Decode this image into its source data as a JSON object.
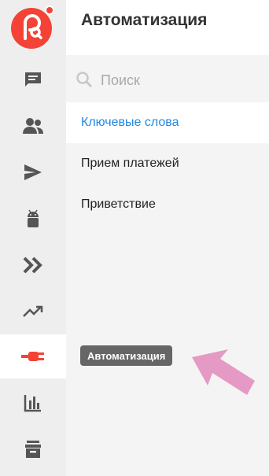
{
  "app": {
    "title": "Автоматизация",
    "accent_color": "#f44336",
    "link_color": "#1e88e5"
  },
  "sidebar": {
    "items": [
      {
        "name": "chat",
        "icon": "chat-icon",
        "active": false
      },
      {
        "name": "contacts",
        "icon": "people-icon",
        "active": false
      },
      {
        "name": "broadcast",
        "icon": "send-icon",
        "active": false
      },
      {
        "name": "bots",
        "icon": "android-icon",
        "active": false
      },
      {
        "name": "flows",
        "icon": "double-chevron-icon",
        "active": false
      },
      {
        "name": "growth",
        "icon": "trending-up-icon",
        "active": false
      },
      {
        "name": "automation",
        "icon": "plug-icon",
        "active": true
      },
      {
        "name": "analytics",
        "icon": "bar-chart-icon",
        "active": false
      },
      {
        "name": "archive",
        "icon": "archive-icon",
        "active": false
      }
    ]
  },
  "search": {
    "placeholder": "Поиск"
  },
  "list": {
    "items": [
      {
        "label": "Ключевые слова",
        "selected": true
      },
      {
        "label": "Прием платежей",
        "selected": false
      },
      {
        "label": "Приветствие",
        "selected": false
      }
    ]
  },
  "tooltip": {
    "text": "Автоматизация"
  },
  "annotation": {
    "arrow_color": "#e49ac4"
  }
}
